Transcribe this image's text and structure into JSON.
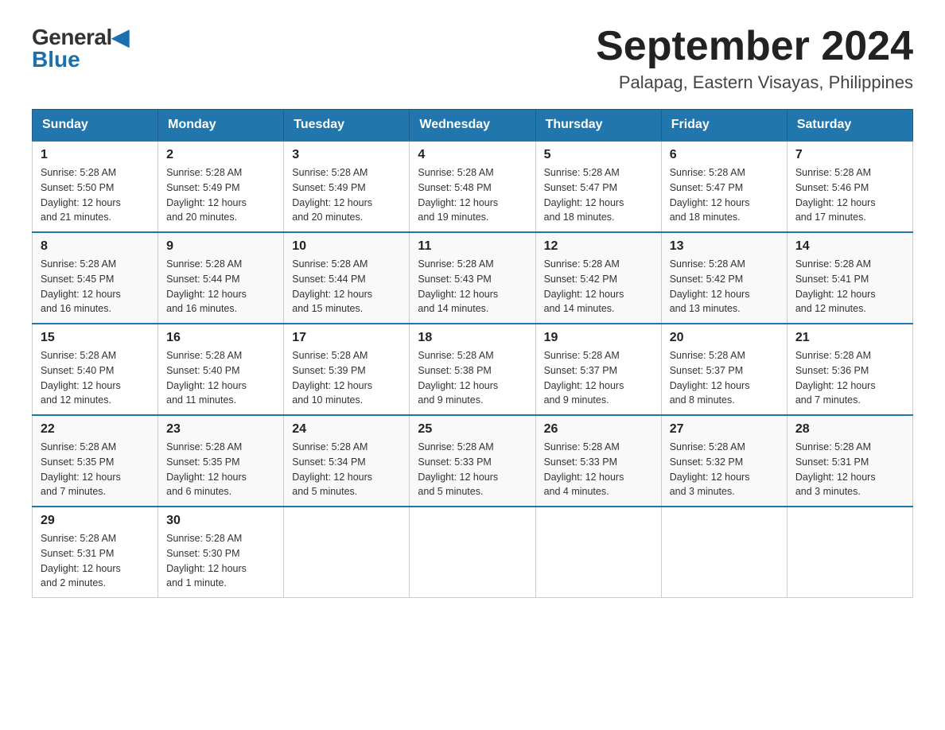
{
  "header": {
    "logo_top": "General",
    "logo_bottom": "Blue",
    "title": "September 2024",
    "subtitle": "Palapag, Eastern Visayas, Philippines"
  },
  "days_of_week": [
    "Sunday",
    "Monday",
    "Tuesday",
    "Wednesday",
    "Thursday",
    "Friday",
    "Saturday"
  ],
  "weeks": [
    [
      {
        "day": "1",
        "sunrise": "5:28 AM",
        "sunset": "5:50 PM",
        "daylight": "12 hours and 21 minutes."
      },
      {
        "day": "2",
        "sunrise": "5:28 AM",
        "sunset": "5:49 PM",
        "daylight": "12 hours and 20 minutes."
      },
      {
        "day": "3",
        "sunrise": "5:28 AM",
        "sunset": "5:49 PM",
        "daylight": "12 hours and 20 minutes."
      },
      {
        "day": "4",
        "sunrise": "5:28 AM",
        "sunset": "5:48 PM",
        "daylight": "12 hours and 19 minutes."
      },
      {
        "day": "5",
        "sunrise": "5:28 AM",
        "sunset": "5:47 PM",
        "daylight": "12 hours and 18 minutes."
      },
      {
        "day": "6",
        "sunrise": "5:28 AM",
        "sunset": "5:47 PM",
        "daylight": "12 hours and 18 minutes."
      },
      {
        "day": "7",
        "sunrise": "5:28 AM",
        "sunset": "5:46 PM",
        "daylight": "12 hours and 17 minutes."
      }
    ],
    [
      {
        "day": "8",
        "sunrise": "5:28 AM",
        "sunset": "5:45 PM",
        "daylight": "12 hours and 16 minutes."
      },
      {
        "day": "9",
        "sunrise": "5:28 AM",
        "sunset": "5:44 PM",
        "daylight": "12 hours and 16 minutes."
      },
      {
        "day": "10",
        "sunrise": "5:28 AM",
        "sunset": "5:44 PM",
        "daylight": "12 hours and 15 minutes."
      },
      {
        "day": "11",
        "sunrise": "5:28 AM",
        "sunset": "5:43 PM",
        "daylight": "12 hours and 14 minutes."
      },
      {
        "day": "12",
        "sunrise": "5:28 AM",
        "sunset": "5:42 PM",
        "daylight": "12 hours and 14 minutes."
      },
      {
        "day": "13",
        "sunrise": "5:28 AM",
        "sunset": "5:42 PM",
        "daylight": "12 hours and 13 minutes."
      },
      {
        "day": "14",
        "sunrise": "5:28 AM",
        "sunset": "5:41 PM",
        "daylight": "12 hours and 12 minutes."
      }
    ],
    [
      {
        "day": "15",
        "sunrise": "5:28 AM",
        "sunset": "5:40 PM",
        "daylight": "12 hours and 12 minutes."
      },
      {
        "day": "16",
        "sunrise": "5:28 AM",
        "sunset": "5:40 PM",
        "daylight": "12 hours and 11 minutes."
      },
      {
        "day": "17",
        "sunrise": "5:28 AM",
        "sunset": "5:39 PM",
        "daylight": "12 hours and 10 minutes."
      },
      {
        "day": "18",
        "sunrise": "5:28 AM",
        "sunset": "5:38 PM",
        "daylight": "12 hours and 9 minutes."
      },
      {
        "day": "19",
        "sunrise": "5:28 AM",
        "sunset": "5:37 PM",
        "daylight": "12 hours and 9 minutes."
      },
      {
        "day": "20",
        "sunrise": "5:28 AM",
        "sunset": "5:37 PM",
        "daylight": "12 hours and 8 minutes."
      },
      {
        "day": "21",
        "sunrise": "5:28 AM",
        "sunset": "5:36 PM",
        "daylight": "12 hours and 7 minutes."
      }
    ],
    [
      {
        "day": "22",
        "sunrise": "5:28 AM",
        "sunset": "5:35 PM",
        "daylight": "12 hours and 7 minutes."
      },
      {
        "day": "23",
        "sunrise": "5:28 AM",
        "sunset": "5:35 PM",
        "daylight": "12 hours and 6 minutes."
      },
      {
        "day": "24",
        "sunrise": "5:28 AM",
        "sunset": "5:34 PM",
        "daylight": "12 hours and 5 minutes."
      },
      {
        "day": "25",
        "sunrise": "5:28 AM",
        "sunset": "5:33 PM",
        "daylight": "12 hours and 5 minutes."
      },
      {
        "day": "26",
        "sunrise": "5:28 AM",
        "sunset": "5:33 PM",
        "daylight": "12 hours and 4 minutes."
      },
      {
        "day": "27",
        "sunrise": "5:28 AM",
        "sunset": "5:32 PM",
        "daylight": "12 hours and 3 minutes."
      },
      {
        "day": "28",
        "sunrise": "5:28 AM",
        "sunset": "5:31 PM",
        "daylight": "12 hours and 3 minutes."
      }
    ],
    [
      {
        "day": "29",
        "sunrise": "5:28 AM",
        "sunset": "5:31 PM",
        "daylight": "12 hours and 2 minutes."
      },
      {
        "day": "30",
        "sunrise": "5:28 AM",
        "sunset": "5:30 PM",
        "daylight": "12 hours and 1 minute."
      },
      null,
      null,
      null,
      null,
      null
    ]
  ],
  "labels": {
    "sunrise": "Sunrise:",
    "sunset": "Sunset:",
    "daylight": "Daylight:"
  }
}
